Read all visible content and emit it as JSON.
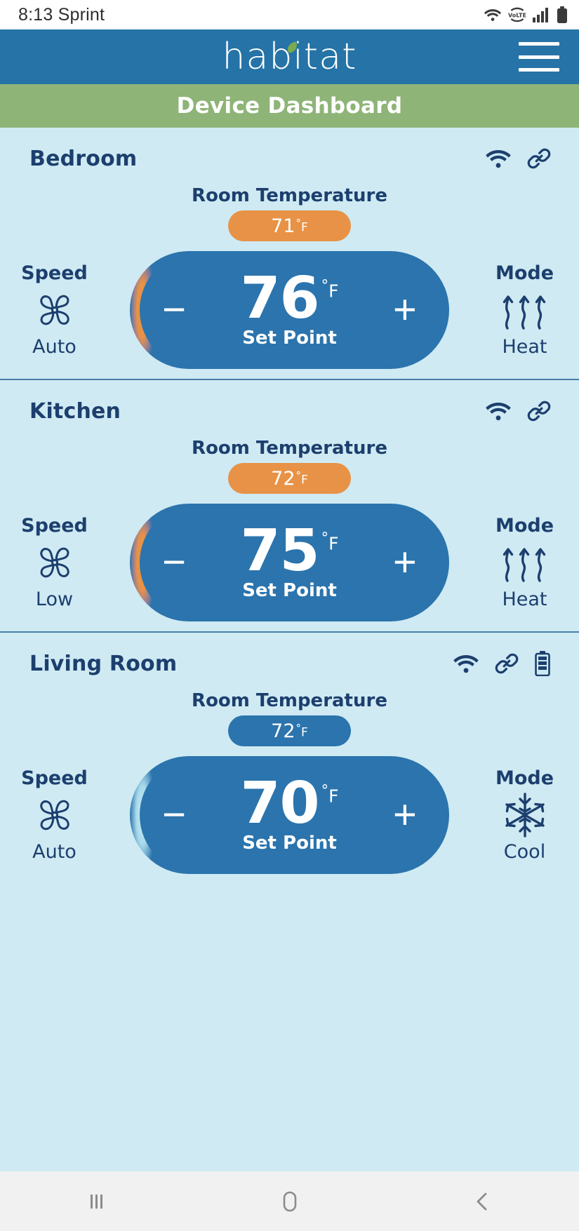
{
  "status_bar": {
    "time": "8:13",
    "carrier": "Sprint",
    "icons": [
      "wifi-icon",
      "volte-icon",
      "signal-bars-icon",
      "battery-icon"
    ],
    "volte_label": "VoLTE"
  },
  "brand": {
    "logo_text": "habitat",
    "logo_leaf": "leaf-accent",
    "menu": "hamburger-menu"
  },
  "page": {
    "title": "Device Dashboard"
  },
  "labels": {
    "room_temperature": "Room Temperature",
    "speed": "Speed",
    "mode": "Mode",
    "set_point": "Set Point",
    "minus": "−",
    "plus": "+",
    "degree": "°",
    "unit": "F"
  },
  "colors": {
    "brand_blue": "#2573a7",
    "title_green": "#8eb477",
    "page_bg": "#cfeaf3",
    "navy_text": "#1c3f6e",
    "dial_blue": "#2b74ad",
    "heat_orange": "#e79246",
    "cool_blue": "#2b74ad",
    "cool_glow": "#cfeff8",
    "nav_bg": "#f1f1f1"
  },
  "devices": [
    {
      "name": "Bedroom",
      "status_icons": [
        "wifi-icon",
        "link-icon"
      ],
      "room_temperature": "71",
      "room_temp_state": "heat",
      "set_point": "76",
      "speed": "Auto",
      "speed_icon": "fan-icon",
      "mode": "Heat",
      "mode_icon": "heat-waves-icon"
    },
    {
      "name": "Kitchen",
      "status_icons": [
        "wifi-icon",
        "link-icon"
      ],
      "room_temperature": "72",
      "room_temp_state": "heat",
      "set_point": "75",
      "speed": "Low",
      "speed_icon": "fan-icon",
      "mode": "Heat",
      "mode_icon": "heat-waves-icon"
    },
    {
      "name": "Living Room",
      "status_icons": [
        "wifi-icon",
        "link-icon",
        "battery-icon"
      ],
      "room_temperature": "72",
      "room_temp_state": "cool",
      "set_point": "70",
      "speed": "Auto",
      "speed_icon": "fan-icon",
      "mode": "Cool",
      "mode_icon": "snowflake-icon"
    }
  ],
  "nav_bar": {
    "recents": "recents-icon",
    "home": "home-icon",
    "back": "back-icon"
  }
}
